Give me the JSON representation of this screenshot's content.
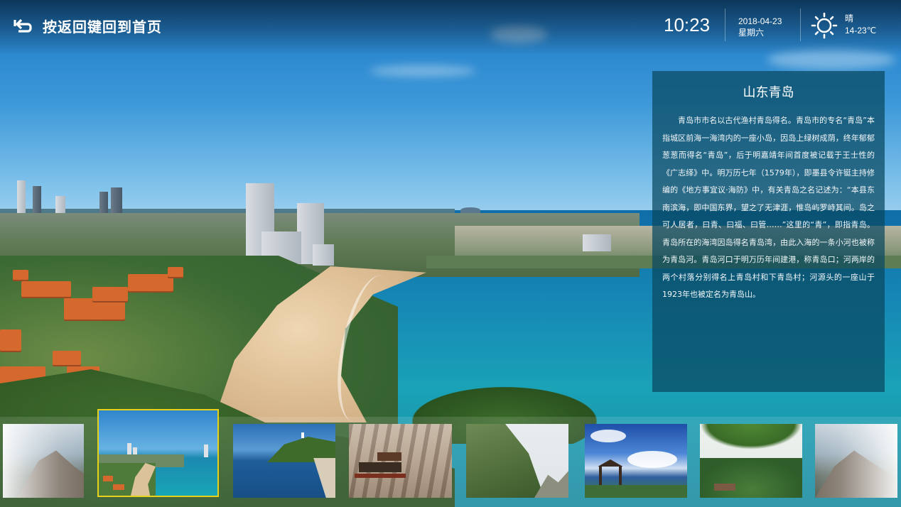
{
  "header": {
    "back_label": "按返回键回到首页",
    "time": "10:23",
    "date": "2018-04-23",
    "weekday": "星期六",
    "weather": "晴",
    "temperature": "14-23℃"
  },
  "info": {
    "title": "山东青岛",
    "body": "青岛市市名以古代渔村青岛得名。青岛市的专名“青岛”本指城区前海一海湾内的一座小岛，因岛上绿树成荫，终年郁郁葱葱而得名“青岛”，后于明嘉靖年间首度被记载于王士性的《广志绎》中。明万历七年（1579年），即墨县令许铤主持修编的《地方事宜议·海防》中，有关青岛之名记述为：“本县东南滨海，即中国东界，望之了无津涯，惟岛屿罗峙其间。岛之可人居者，曰青、曰福、曰管……”这里的“青”，即指青岛。青岛所在的海湾因岛得名青岛湾，由此入海的一条小河也被称为青岛河。青岛河口于明万历年间建港，称青岛口；河两岸的两个村落分别得名上青岛村和下青岛村；河源头的一座山于1923年也被定名为青岛山。"
  },
  "thumbnails": [
    {
      "name": "mountain-coast-left",
      "selected": false
    },
    {
      "name": "qingdao-beach",
      "selected": true
    },
    {
      "name": "island-bay",
      "selected": false
    },
    {
      "name": "hanging-temple-cliff",
      "selected": false
    },
    {
      "name": "green-mountain",
      "selected": false
    },
    {
      "name": "pavilion-lake",
      "selected": false
    },
    {
      "name": "forest-trees",
      "selected": false
    },
    {
      "name": "mountain-coast-right",
      "selected": false
    }
  ],
  "colors": {
    "selected_border": "#e6d21a",
    "panel_bg": "#084860"
  },
  "icons": {
    "back": "back-arrow-icon",
    "weather": "sun-icon"
  }
}
